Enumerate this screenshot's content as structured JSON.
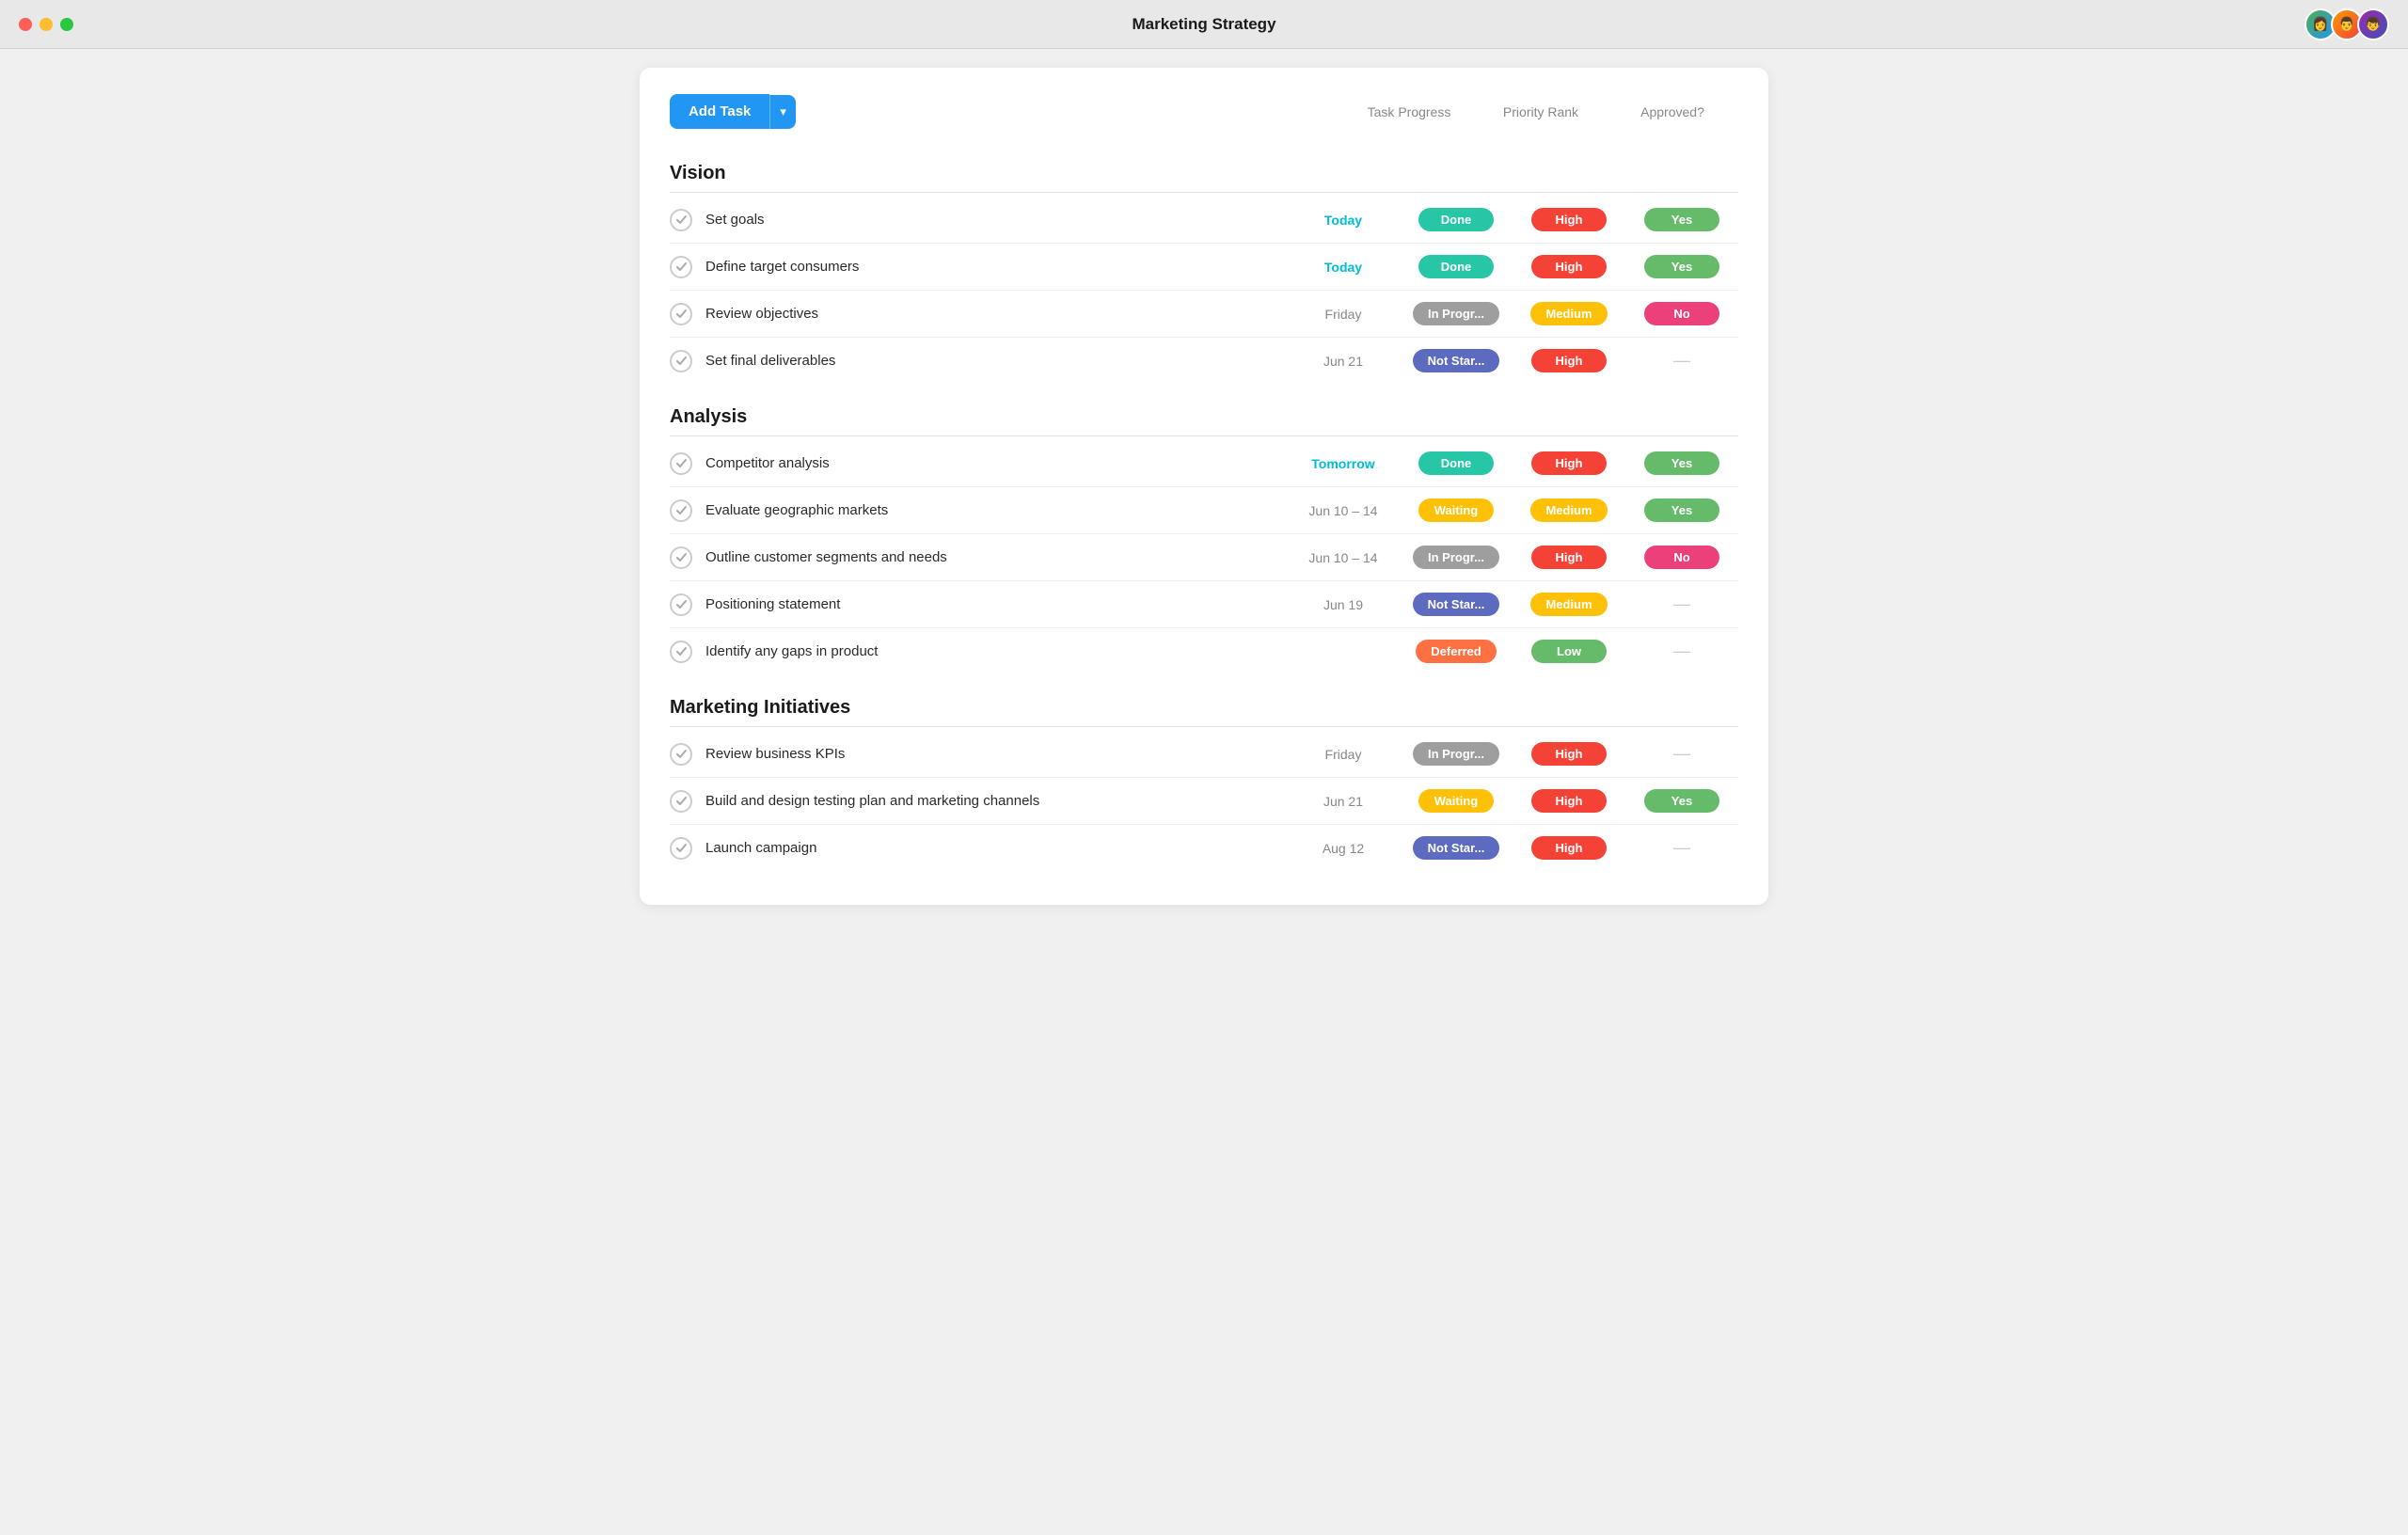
{
  "window": {
    "title": "Marketing Strategy"
  },
  "toolbar": {
    "add_task_label": "Add Task",
    "dropdown_icon": "▾",
    "col_headers": [
      {
        "id": "progress",
        "label": "Task Progress"
      },
      {
        "id": "priority",
        "label": "Priority Rank"
      },
      {
        "id": "approved",
        "label": "Approved?"
      }
    ]
  },
  "sections": [
    {
      "id": "vision",
      "title": "Vision",
      "tasks": [
        {
          "id": 1,
          "name": "Set goals",
          "date": "Today",
          "date_type": "today",
          "progress": "Done",
          "priority": "High",
          "approved": "Yes"
        },
        {
          "id": 2,
          "name": "Define target consumers",
          "date": "Today",
          "date_type": "today",
          "progress": "Done",
          "priority": "High",
          "approved": "Yes"
        },
        {
          "id": 3,
          "name": "Review objectives",
          "date": "Friday",
          "date_type": "normal",
          "progress": "In Progr...",
          "priority": "Medium",
          "approved": "No"
        },
        {
          "id": 4,
          "name": "Set final deliverables",
          "date": "Jun 21",
          "date_type": "normal",
          "progress": "Not Star...",
          "priority": "High",
          "approved": ""
        }
      ]
    },
    {
      "id": "analysis",
      "title": "Analysis",
      "tasks": [
        {
          "id": 5,
          "name": "Competitor analysis",
          "date": "Tomorrow",
          "date_type": "tomorrow",
          "progress": "Done",
          "priority": "High",
          "approved": "Yes"
        },
        {
          "id": 6,
          "name": "Evaluate geographic markets",
          "date": "Jun 10 – 14",
          "date_type": "normal",
          "progress": "Waiting",
          "priority": "Medium",
          "approved": "Yes"
        },
        {
          "id": 7,
          "name": "Outline customer segments and needs",
          "date": "Jun 10 – 14",
          "date_type": "normal",
          "progress": "In Progr...",
          "priority": "High",
          "approved": "No"
        },
        {
          "id": 8,
          "name": "Positioning statement",
          "date": "Jun 19",
          "date_type": "normal",
          "progress": "Not Star...",
          "priority": "Medium",
          "approved": ""
        },
        {
          "id": 9,
          "name": "Identify any gaps in product",
          "date": "",
          "date_type": "normal",
          "progress": "Deferred",
          "priority": "Low",
          "approved": ""
        }
      ]
    },
    {
      "id": "marketing-initiatives",
      "title": "Marketing Initiatives",
      "tasks": [
        {
          "id": 10,
          "name": "Review business KPIs",
          "date": "Friday",
          "date_type": "normal",
          "progress": "In Progr...",
          "priority": "High",
          "approved": ""
        },
        {
          "id": 11,
          "name": "Build and design testing plan and marketing channels",
          "date": "Jun 21",
          "date_type": "normal",
          "progress": "Waiting",
          "priority": "High",
          "approved": "Yes"
        },
        {
          "id": 12,
          "name": "Launch campaign",
          "date": "Aug 12",
          "date_type": "normal",
          "progress": "Not Star...",
          "priority": "High",
          "approved": ""
        }
      ]
    }
  ],
  "avatars": [
    {
      "id": "avatar-1",
      "color1": "#4CAF50",
      "color2": "#2196F3",
      "emoji": "👩"
    },
    {
      "id": "avatar-2",
      "color1": "#FF9800",
      "color2": "#F44336",
      "emoji": "👨"
    },
    {
      "id": "avatar-3",
      "color1": "#9C27B0",
      "color2": "#3F51B5",
      "emoji": "👦"
    }
  ],
  "colors": {
    "accent": "#2196F3",
    "done": "#26C6A6",
    "in_progress": "#9E9E9E",
    "not_started": "#5C6BC0",
    "waiting": "#FFC107",
    "deferred": "#FF7043",
    "high": "#F44336",
    "medium": "#FFC107",
    "low": "#66BB6A",
    "yes": "#66BB6A",
    "no": "#EC407A"
  }
}
